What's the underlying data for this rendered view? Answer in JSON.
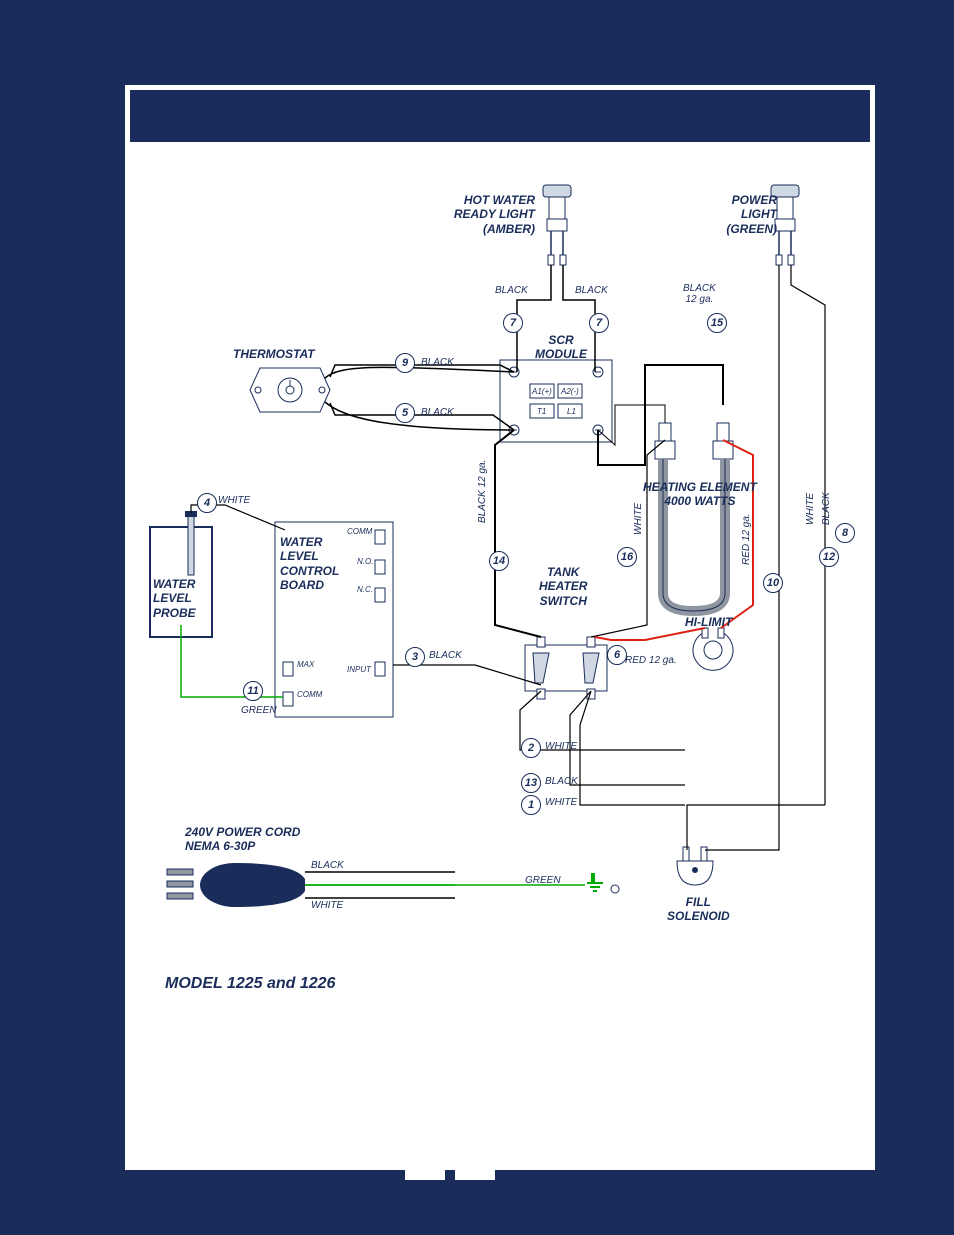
{
  "model_caption": "MODEL 1225 and 1226",
  "components": {
    "hot_water_light": "HOT WATER\nREADY LIGHT\n(AMBER)",
    "power_light": "POWER\nLIGHT\n(GREEN)",
    "thermostat": "THERMOSTAT",
    "scr_module": "SCR\nMODULE",
    "water_level_board": "WATER\nLEVEL\nCONTROL\nBOARD",
    "water_level_probe": "WATER\nLEVEL\nPROBE",
    "heating_element": "HEATING ELEMENT\n4000 WATTS",
    "tank_heater_switch": "TANK\nHEATER\nSWITCH",
    "hi_limit": "HI-LIMIT",
    "power_cord": "240V POWER CORD\nNEMA 6-30P",
    "fill_solenoid": "FILL\nSOLENOID"
  },
  "wire_colors": {
    "black": "BLACK",
    "white": "WHITE",
    "green": "GREEN",
    "black_12ga": "BLACK\n12 ga.",
    "black_12ga_inline": "BLACK 12 ga.",
    "red_12ga": "RED 12 ga.",
    "red_12ga_inline": "RED 12 ga."
  },
  "board_terminals": {
    "comm": "COMM",
    "no": "N.O.",
    "nc": "N.C.",
    "max": "MAX",
    "input": "INPUT",
    "comm2": "COMM"
  },
  "scr_terminals": {
    "a1": "A1(+)",
    "a2": "A2(-)",
    "t1": "T1",
    "l1": "L1"
  },
  "nodes": {
    "n1": "1",
    "n2": "2",
    "n3": "3",
    "n4": "4",
    "n5": "5",
    "n6": "6",
    "n7": "7",
    "n8": "8",
    "n9": "9",
    "n10": "10",
    "n11": "11",
    "n12": "12",
    "n13": "13",
    "n14": "14",
    "n15": "15",
    "n16": "16"
  }
}
